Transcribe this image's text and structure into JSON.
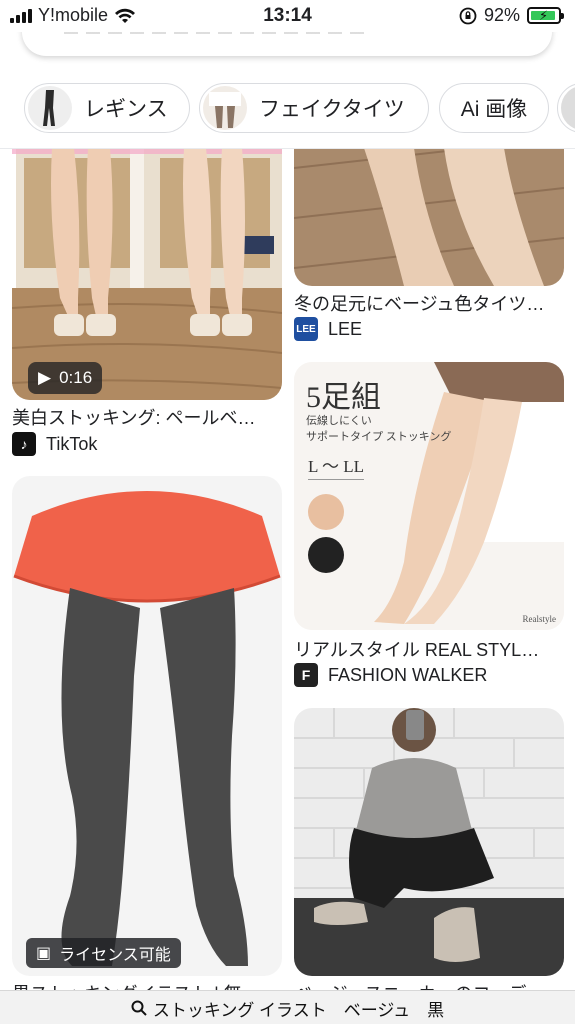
{
  "status_bar": {
    "carrier": "Y!mobile",
    "time": "13:14",
    "battery_percent": "92%",
    "battery_level": 0.92
  },
  "chips": [
    {
      "label": "レギンス",
      "has_thumb": true
    },
    {
      "label": "フェイクタイツ",
      "has_thumb": true
    },
    {
      "label": "Ai 画像",
      "has_thumb": false
    }
  ],
  "results": {
    "left": [
      {
        "title": "美白ストッキング: ペールベ…",
        "source": "TikTok",
        "video_duration": "0:16"
      },
      {
        "title": "黒ストッキングイラスト | 無…",
        "badge": "ライセンス可能"
      }
    ],
    "right": [
      {
        "title": "冬の足元にベージュ色タイツ…",
        "source": "LEE"
      },
      {
        "title": "リアルスタイル REAL STYL…",
        "source": "FASHION WALKER",
        "overlay_heading": "5足組",
        "overlay_line1": "伝線しにくい",
        "overlay_line2": "サポートタイプ ストッキング",
        "overlay_size": "L 〜 LL",
        "overlay_brand": "Realstyle"
      },
      {
        "title": "ベージュスニーカーのコーデ…"
      }
    ]
  },
  "bottom_bar": {
    "query": "ストッキング イラスト　ベージュ　黒"
  },
  "colors": {
    "battery_green": "#34c759",
    "skirt_orange": "#f0624a",
    "tights_dark": "#4a4a4a",
    "tiktok_bg": "#111111",
    "lee_blue": "#1f4fa0"
  }
}
